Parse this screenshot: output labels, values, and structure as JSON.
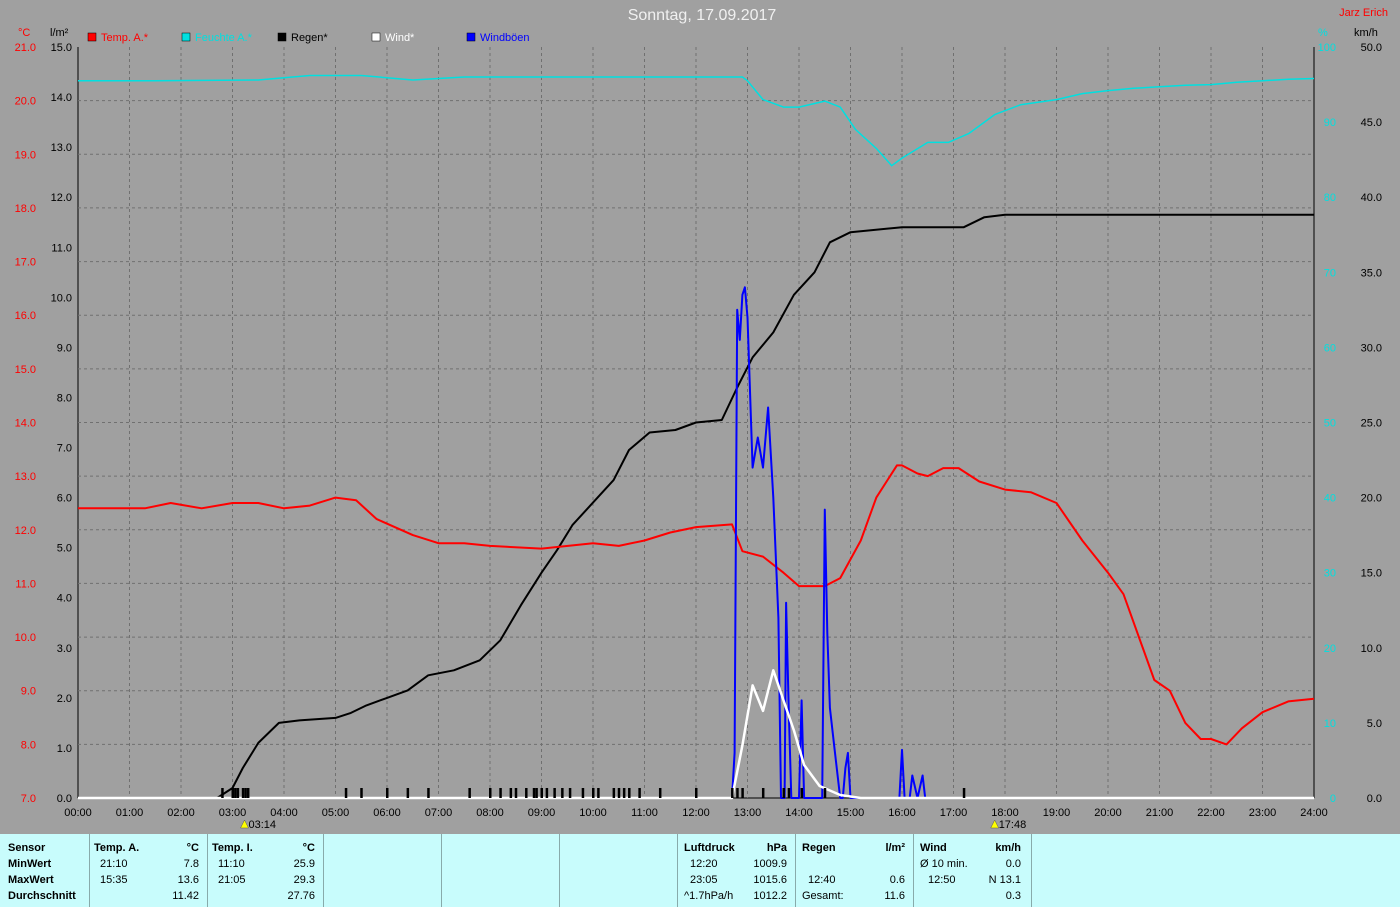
{
  "title": "Sonntag, 17.09.2017",
  "author": "Jarz Erich",
  "colors": {
    "temp": "#ff0000",
    "humidity": "#00e0e0",
    "rain": "#000000",
    "wind": "#ffffff",
    "gust": "#0000ff",
    "background": "#a0a0a0",
    "table": "#c8fcfc"
  },
  "legend": [
    {
      "label": "Temp. A.*",
      "color": "#ff0000"
    },
    {
      "label": "Feuchte A.*",
      "color": "#00e0e0"
    },
    {
      "label": "Regen*",
      "color": "#000000"
    },
    {
      "label": "Wind*",
      "color": "#ffffff"
    },
    {
      "label": "Windböen",
      "color": "#0000ff"
    }
  ],
  "axes": {
    "temp_unit": "°C",
    "rain_unit": "l/m²",
    "humidity_unit": "%",
    "wind_unit": "km/h",
    "temp_ticks": [
      "21.0",
      "20.0",
      "19.0",
      "18.0",
      "17.0",
      "16.0",
      "15.0",
      "14.0",
      "13.0",
      "12.0",
      "11.0",
      "10.0",
      "9.0",
      "8.0",
      "7.0"
    ],
    "rain_ticks": [
      "15.0",
      "14.0",
      "13.0",
      "12.0",
      "11.0",
      "10.0",
      "9.0",
      "8.0",
      "7.0",
      "6.0",
      "5.0",
      "4.0",
      "3.0",
      "2.0",
      "1.0",
      "0.0"
    ],
    "humidity_ticks": [
      "100",
      "90",
      "80",
      "70",
      "60",
      "50",
      "40",
      "30",
      "20",
      "10",
      "0"
    ],
    "wind_ticks": [
      "50.0",
      "45.0",
      "40.0",
      "35.0",
      "30.0",
      "25.0",
      "20.0",
      "15.0",
      "10.0",
      "5.0",
      "0.0"
    ],
    "x_ticks": [
      "00:00",
      "01:00",
      "02:00",
      "03:00",
      "04:00",
      "05:00",
      "06:00",
      "07:00",
      "08:00",
      "09:00",
      "10:00",
      "11:00",
      "12:00",
      "13:00",
      "14:00",
      "15:00",
      "16:00",
      "17:00",
      "18:00",
      "19:00",
      "20:00",
      "21:00",
      "22:00",
      "23:00",
      "24:00"
    ],
    "sunrise": "03:14",
    "sunset": "17:48"
  },
  "chart_data": {
    "type": "line",
    "title": "Sonntag, 17.09.2017",
    "x_range_hours": [
      0,
      24
    ],
    "ylim_temp": [
      7.0,
      21.0
    ],
    "ylim_rain": [
      0.0,
      15.0
    ],
    "ylim_humidity": [
      0,
      100
    ],
    "ylim_wind": [
      0.0,
      50.0
    ],
    "grid": true,
    "series": [
      {
        "name": "Temp. A.*",
        "axis": "temp",
        "points": [
          [
            0,
            12.4
          ],
          [
            1.3,
            12.4
          ],
          [
            1.8,
            12.5
          ],
          [
            2.4,
            12.4
          ],
          [
            3.0,
            12.5
          ],
          [
            3.5,
            12.5
          ],
          [
            4.0,
            12.4
          ],
          [
            4.5,
            12.45
          ],
          [
            5.0,
            12.6
          ],
          [
            5.4,
            12.55
          ],
          [
            5.8,
            12.2
          ],
          [
            6.5,
            11.9
          ],
          [
            7.0,
            11.75
          ],
          [
            7.5,
            11.75
          ],
          [
            8.0,
            11.7
          ],
          [
            9.0,
            11.65
          ],
          [
            10.0,
            11.75
          ],
          [
            10.5,
            11.7
          ],
          [
            11.0,
            11.8
          ],
          [
            11.5,
            11.95
          ],
          [
            12.0,
            12.05
          ],
          [
            12.7,
            12.1
          ],
          [
            12.9,
            11.6
          ],
          [
            13.3,
            11.5
          ],
          [
            13.7,
            11.2
          ],
          [
            14.0,
            10.95
          ],
          [
            14.5,
            10.95
          ],
          [
            14.8,
            11.1
          ],
          [
            15.2,
            11.8
          ],
          [
            15.5,
            12.6
          ],
          [
            15.9,
            13.2
          ],
          [
            16.0,
            13.2
          ],
          [
            16.3,
            13.05
          ],
          [
            16.5,
            13.0
          ],
          [
            16.8,
            13.15
          ],
          [
            17.1,
            13.15
          ],
          [
            17.5,
            12.9
          ],
          [
            18.0,
            12.75
          ],
          [
            18.5,
            12.7
          ],
          [
            19.0,
            12.5
          ],
          [
            19.5,
            11.8
          ],
          [
            20.0,
            11.2
          ],
          [
            20.3,
            10.8
          ],
          [
            20.6,
            10.0
          ],
          [
            20.9,
            9.2
          ],
          [
            21.2,
            9.0
          ],
          [
            21.5,
            8.4
          ],
          [
            21.8,
            8.1
          ],
          [
            22.0,
            8.1
          ],
          [
            22.3,
            8.0
          ],
          [
            22.6,
            8.3
          ],
          [
            23.0,
            8.6
          ],
          [
            23.5,
            8.8
          ],
          [
            24.0,
            8.85
          ]
        ]
      },
      {
        "name": "Feuchte A.*",
        "axis": "humidity",
        "points": [
          [
            0,
            95.5
          ],
          [
            1.5,
            95.5
          ],
          [
            3.5,
            95.6
          ],
          [
            4.5,
            96.2
          ],
          [
            5.5,
            96.2
          ],
          [
            6.5,
            95.6
          ],
          [
            7.5,
            96
          ],
          [
            12.9,
            96
          ],
          [
            13.0,
            95.5
          ],
          [
            13.3,
            93
          ],
          [
            13.7,
            92
          ],
          [
            14.0,
            92
          ],
          [
            14.5,
            92.8
          ],
          [
            14.8,
            92
          ],
          [
            15.1,
            89
          ],
          [
            15.5,
            86.5
          ],
          [
            15.8,
            84.2
          ],
          [
            16.0,
            85.2
          ],
          [
            16.5,
            87.3
          ],
          [
            16.9,
            87.3
          ],
          [
            17.3,
            88.5
          ],
          [
            17.8,
            91
          ],
          [
            18.3,
            92.3
          ],
          [
            19.0,
            93
          ],
          [
            19.5,
            93.8
          ],
          [
            20.0,
            94.2
          ],
          [
            20.5,
            94.5
          ],
          [
            21.0,
            94.7
          ],
          [
            21.5,
            94.9
          ],
          [
            22.0,
            95
          ],
          [
            22.5,
            95.3
          ],
          [
            23.0,
            95.5
          ],
          [
            23.5,
            95.7
          ],
          [
            24.0,
            95.8
          ]
        ]
      },
      {
        "name": "Regen*",
        "axis": "rain",
        "points": [
          [
            0,
            0
          ],
          [
            2.7,
            0
          ],
          [
            3.0,
            0.2
          ],
          [
            3.2,
            0.6
          ],
          [
            3.5,
            1.1
          ],
          [
            3.9,
            1.5
          ],
          [
            4.3,
            1.55
          ],
          [
            5.0,
            1.6
          ],
          [
            5.3,
            1.7
          ],
          [
            5.6,
            1.85
          ],
          [
            6.0,
            2.0
          ],
          [
            6.4,
            2.15
          ],
          [
            6.8,
            2.45
          ],
          [
            7.3,
            2.55
          ],
          [
            7.8,
            2.75
          ],
          [
            8.2,
            3.15
          ],
          [
            8.6,
            3.85
          ],
          [
            9.0,
            4.5
          ],
          [
            9.3,
            4.95
          ],
          [
            9.6,
            5.45
          ],
          [
            10.0,
            5.9
          ],
          [
            10.4,
            6.35
          ],
          [
            10.7,
            6.95
          ],
          [
            11.1,
            7.3
          ],
          [
            11.6,
            7.35
          ],
          [
            12.0,
            7.5
          ],
          [
            12.5,
            7.55
          ],
          [
            12.8,
            8.2
          ],
          [
            13.1,
            8.8
          ],
          [
            13.5,
            9.3
          ],
          [
            13.9,
            10.05
          ],
          [
            14.3,
            10.5
          ],
          [
            14.6,
            11.1
          ],
          [
            15.0,
            11.3
          ],
          [
            16.0,
            11.4
          ],
          [
            17.2,
            11.4
          ],
          [
            17.6,
            11.6
          ],
          [
            18.0,
            11.65
          ],
          [
            24.0,
            11.65
          ]
        ]
      },
      {
        "name": "Wind*",
        "axis": "wind",
        "points": [
          [
            0,
            0
          ],
          [
            12.7,
            0
          ],
          [
            12.9,
            3.5
          ],
          [
            13.1,
            7.5
          ],
          [
            13.3,
            5.8
          ],
          [
            13.5,
            8.5
          ],
          [
            13.7,
            6.5
          ],
          [
            13.9,
            4.5
          ],
          [
            14.1,
            2.2
          ],
          [
            14.4,
            0.8
          ],
          [
            14.8,
            0.2
          ],
          [
            15.2,
            0
          ],
          [
            24,
            0
          ]
        ]
      },
      {
        "name": "Windböen",
        "axis": "wind",
        "points": [
          [
            0,
            0
          ],
          [
            12.7,
            0
          ],
          [
            12.75,
            3
          ],
          [
            12.8,
            32.5
          ],
          [
            12.85,
            30.5
          ],
          [
            12.9,
            33.5
          ],
          [
            12.95,
            34
          ],
          [
            13.0,
            32
          ],
          [
            13.1,
            22
          ],
          [
            13.2,
            24
          ],
          [
            13.3,
            22
          ],
          [
            13.4,
            26
          ],
          [
            13.5,
            20
          ],
          [
            13.6,
            12
          ],
          [
            13.65,
            0
          ],
          [
            13.72,
            0
          ],
          [
            13.75,
            13
          ],
          [
            13.8,
            6
          ],
          [
            13.85,
            0
          ],
          [
            14.0,
            0
          ],
          [
            14.05,
            6.5
          ],
          [
            14.1,
            0
          ],
          [
            14.45,
            0
          ],
          [
            14.5,
            19.2
          ],
          [
            14.55,
            11
          ],
          [
            14.6,
            6
          ],
          [
            14.7,
            3
          ],
          [
            14.8,
            0
          ],
          [
            14.85,
            0
          ],
          [
            14.9,
            2
          ],
          [
            14.95,
            3
          ],
          [
            15.0,
            0
          ],
          [
            15.95,
            0
          ],
          [
            16.0,
            3.2
          ],
          [
            16.05,
            0
          ],
          [
            16.15,
            0
          ],
          [
            16.2,
            1.5
          ],
          [
            16.3,
            0
          ],
          [
            16.4,
            1.5
          ],
          [
            16.45,
            0
          ],
          [
            24,
            0
          ]
        ]
      }
    ],
    "rain_events": [
      2.8,
      3.0,
      3.05,
      3.1,
      3.2,
      3.25,
      3.3,
      5.2,
      5.5,
      6.0,
      6.4,
      6.8,
      7.6,
      8.0,
      8.2,
      8.4,
      8.5,
      8.7,
      8.85,
      8.9,
      9.0,
      9.1,
      9.25,
      9.4,
      9.55,
      9.8,
      10.0,
      10.1,
      10.4,
      10.5,
      10.6,
      10.7,
      10.9,
      11.3,
      12.0,
      12.7,
      12.8,
      12.9,
      13.3,
      13.7,
      13.8,
      14.05,
      14.5,
      17.2
    ]
  },
  "table": {
    "headers": {
      "sensor": "Sensor",
      "temp_a": "Temp. A.",
      "temp_a_unit": "°C",
      "temp_i": "Temp. I.",
      "temp_i_unit": "°C",
      "pressure": "Luftdruck",
      "pressure_unit": "hPa",
      "rain": "Regen",
      "rain_unit": "l/m²",
      "wind": "Wind",
      "wind_unit": "km/h"
    },
    "rows": {
      "min_label": "MinWert",
      "max_label": "MaxWert",
      "avg_label": "Durchschnitt"
    },
    "temp_a": {
      "min_time": "21:10",
      "min_val": "7.8",
      "max_time": "15:35",
      "max_val": "13.6",
      "avg_val": "11.42"
    },
    "temp_i": {
      "min_time": "11:10",
      "min_val": "25.9",
      "max_time": "21:05",
      "max_val": "29.3",
      "avg_val": "27.76"
    },
    "pressure": {
      "min_time": "12:20",
      "min_val": "1009.9",
      "max_time": "23:05",
      "max_val": "1015.6",
      "trend": "^1.7hPa/h",
      "avg_val": "1012.2"
    },
    "rain": {
      "max_time": "12:40",
      "max_val": "0.6",
      "total_label": "Gesamt:",
      "total_val": "11.6"
    },
    "wind": {
      "avg_label": "Ø 10 min.",
      "avg_val": "0.0",
      "max_time": "12:50",
      "max_val": "N 13.1",
      "day_avg": "0.3"
    }
  }
}
